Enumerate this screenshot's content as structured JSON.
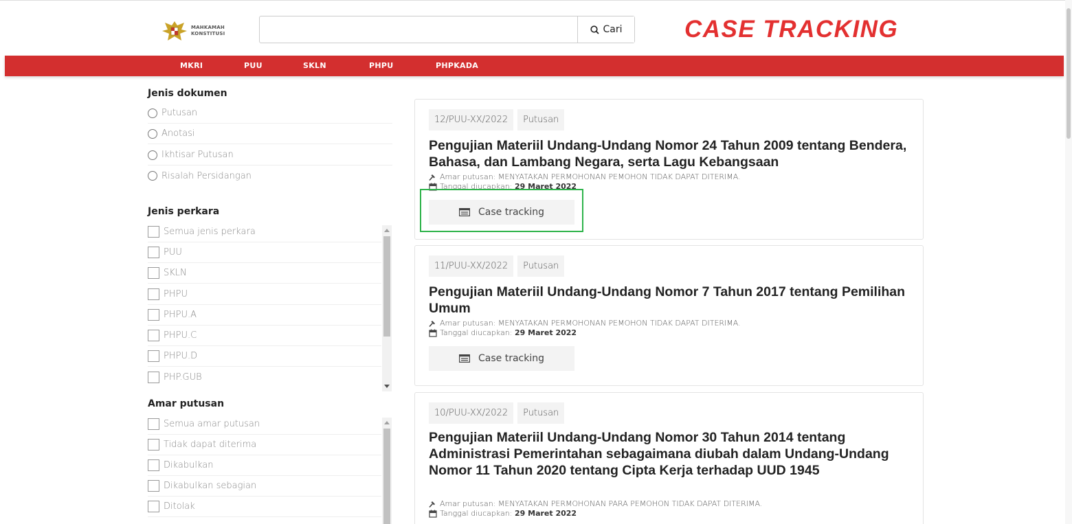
{
  "header": {
    "logo_line1": "MAHKAMAH",
    "logo_line2": "KONSTITUSI",
    "search_value": "",
    "search_button": "Cari",
    "title": "CASE TRACKING"
  },
  "nav": [
    {
      "label": "MKRI"
    },
    {
      "label": "PUU"
    },
    {
      "label": "SKLN"
    },
    {
      "label": "PHPU"
    },
    {
      "label": "PHPKADA"
    }
  ],
  "sidebar": {
    "jenis_dokumen": {
      "title": "Jenis dokumen",
      "options": [
        "Putusan",
        "Anotasi",
        "Ikhtisar Putusan",
        "Risalah Persidangan"
      ]
    },
    "jenis_perkara": {
      "title": "Jenis perkara",
      "options": [
        "Semua jenis perkara",
        "PUU",
        "SKLN",
        "PHPU",
        "PHPU.A",
        "PHPU.C",
        "PHPU.D",
        "PHP.GUB"
      ]
    },
    "amar_putusan": {
      "title": "Amar putusan",
      "options": [
        "Semua amar putusan",
        "Tidak dapat diterima",
        "Dikabulkan",
        "Dikabulkan sebagian",
        "Ditolak"
      ]
    }
  },
  "results": [
    {
      "number": "12/PUU-XX/2022",
      "type": "Putusan",
      "title": "Pengujian Materiil Undang-Undang Nomor 24 Tahun 2009 tentang Bendera, Bahasa, dan Lambang Negara, serta Lagu Kebangsaan",
      "amar_label": "Amar putusan:",
      "amar_value": "MENYATAKAN PERMOHONAN PEMOHON TIDAK DAPAT DITERIMA.",
      "tanggal_label": "Tanggal diucapkan:",
      "tanggal_value": "29 Maret 2022",
      "button": "Case tracking"
    },
    {
      "number": "11/PUU-XX/2022",
      "type": "Putusan",
      "title": "Pengujian Materiil Undang-Undang Nomor 7 Tahun 2017 tentang Pemilihan Umum",
      "amar_label": "Amar putusan:",
      "amar_value": "MENYATAKAN PERMOHONAN PEMOHON TIDAK DAPAT DITERIMA.",
      "tanggal_label": "Tanggal diucapkan:",
      "tanggal_value": "29 Maret 2022",
      "button": "Case tracking"
    },
    {
      "number": "10/PUU-XX/2022",
      "type": "Putusan",
      "title": "Pengujian Materiil Undang-Undang Nomor 30 Tahun 2014 tentang Administrasi Pemerintahan sebagaimana diubah dalam Undang-Undang Nomor 11 Tahun 2020 tentang Cipta Kerja terhadap UUD 1945",
      "amar_label": "Amar putusan:",
      "amar_value": "MENYATAKAN PERMOHONAN PARA PEMOHON TIDAK DAPAT DITERIMA.",
      "tanggal_label": "Tanggal diucapkan:",
      "tanggal_value": "29 Maret 2022"
    }
  ],
  "colors": {
    "brand_red": "#d32f2f",
    "title_red": "#e33030",
    "highlight_green": "#2db34a"
  },
  "icons": [
    "search-icon",
    "gavel-icon",
    "calendar-icon",
    "list-icon",
    "garuda-emblem"
  ]
}
